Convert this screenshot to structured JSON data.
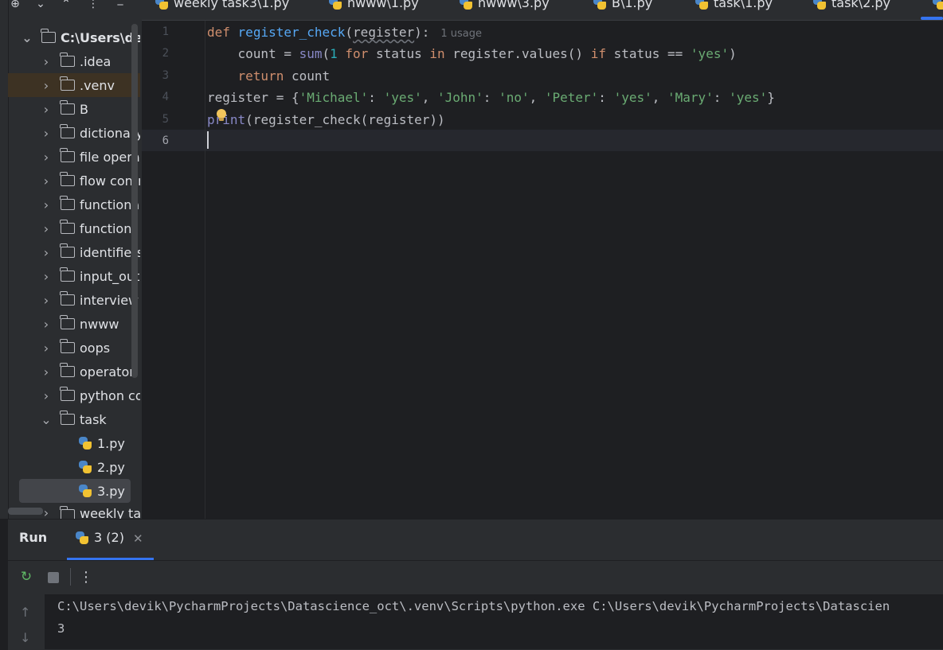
{
  "project_tree": {
    "root": "C:\\Users\\de",
    "items": [
      {
        "label": ".idea"
      },
      {
        "label": ".venv"
      },
      {
        "label": "B"
      },
      {
        "label": "dictionary"
      },
      {
        "label": "file operat"
      },
      {
        "label": "flow contr"
      },
      {
        "label": "functional"
      },
      {
        "label": "functions"
      },
      {
        "label": "identifiers"
      },
      {
        "label": "input_outp"
      },
      {
        "label": "interview"
      },
      {
        "label": "nwww"
      },
      {
        "label": "oops"
      },
      {
        "label": "operator"
      },
      {
        "label": "python co"
      },
      {
        "label": "task"
      }
    ],
    "task_files": [
      "1.py",
      "2.py",
      "3.py"
    ],
    "after": "weekly tas"
  },
  "tabs": [
    {
      "label": "weekly task3\\1.py"
    },
    {
      "label": "nwww\\1.py"
    },
    {
      "label": "nwww\\3.py"
    },
    {
      "label": "B\\1.py"
    },
    {
      "label": "task\\1.py"
    },
    {
      "label": "task\\2.py"
    }
  ],
  "editor": {
    "line_numbers": [
      "1",
      "2",
      "3",
      "4",
      "5",
      "6"
    ],
    "line1": {
      "kw": "def",
      "fn": "register_check",
      "open": "(",
      "param": "register",
      "close": "):",
      "hint": "1 usage"
    },
    "line2": {
      "indent": "    ",
      "a": "count = ",
      "sum": "sum",
      "b": "(",
      "one": "1",
      "c": " ",
      "for": "for",
      "d": " status ",
      "in": "in",
      "e": " register.values() ",
      "if": "if",
      "f": " status == ",
      "yes": "'yes'",
      "g": ")"
    },
    "line3": {
      "indent": "    ",
      "ret": "return",
      "rest": " count"
    },
    "line4": {
      "a": "register = {",
      "k1": "'Michael'",
      "s1": ": ",
      "v1": "'yes'",
      "c1": ", ",
      "k2": "'John'",
      "s2": ": ",
      "v2": "'no'",
      "c2": ", ",
      "k3": "'Peter'",
      "s3": ": ",
      "v3": "'yes'",
      "c3": ", ",
      "k4": "'Mary'",
      "s4": ": ",
      "v4": "'yes'",
      "end": "}"
    },
    "line5": {
      "print": "print",
      "rest": "(register_check(register))"
    }
  },
  "run": {
    "title": "Run",
    "tab_label": "3 (2)",
    "console": [
      "C:\\Users\\devik\\PycharmProjects\\Datascience_oct\\.venv\\Scripts\\python.exe C:\\Users\\devik\\PycharmProjects\\Datascien",
      "3"
    ]
  },
  "colors": {
    "background": "#1e1f22",
    "panel": "#2b2d30",
    "accent": "#3574f0",
    "keyword": "#cf8e6d",
    "function": "#56a8f5",
    "string": "#6aab73",
    "number": "#2aacb8"
  },
  "icons": [
    "add-icon",
    "chevron-down-icon",
    "chevron-up-icon",
    "more-icon",
    "folder-icon",
    "python-file-icon",
    "bulb-icon",
    "rerun-icon",
    "stop-icon",
    "close-icon",
    "arrow-up-icon",
    "arrow-down-icon"
  ]
}
